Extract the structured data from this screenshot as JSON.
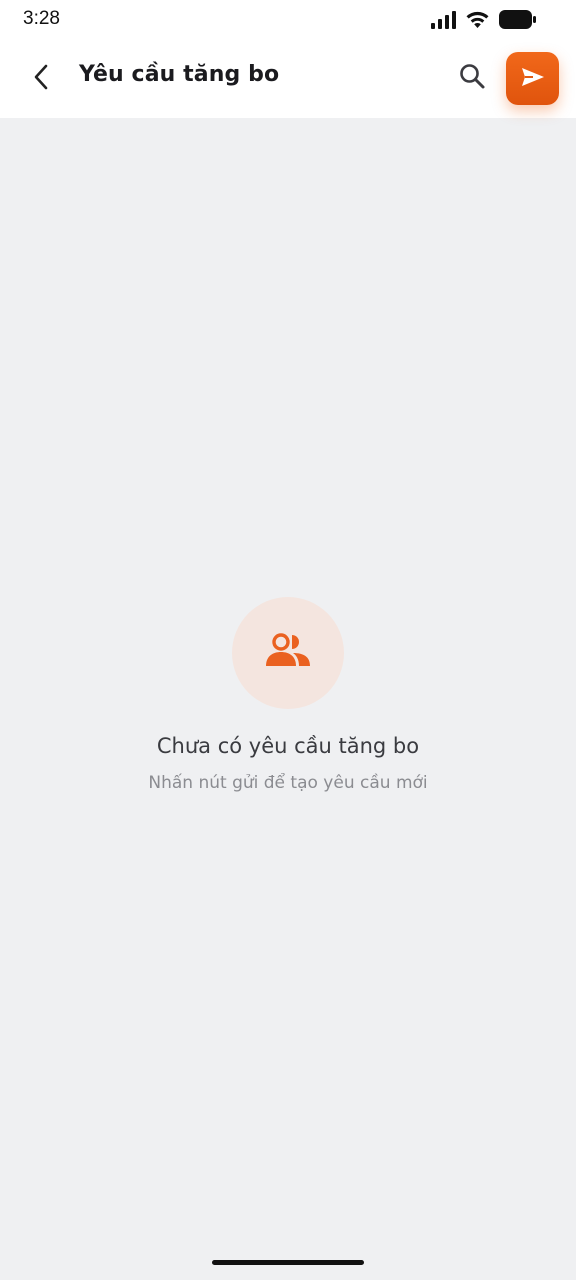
{
  "status_bar": {
    "time": "3:28",
    "icons": [
      "cellular-signal-icon",
      "wifi-icon",
      "battery-icon"
    ]
  },
  "header": {
    "title": "Yêu cầu tăng bo",
    "back_icon": "chevron-left-icon",
    "search_icon": "search-icon",
    "send_icon": "send-icon"
  },
  "empty_state": {
    "icon": "users-icon",
    "title": "Chưa có yêu cầu tăng bo",
    "subtitle": "Nhấn nút gửi để tạo yêu cầu mới"
  },
  "colors": {
    "accent": "#ef661e",
    "background": "#eff0f2",
    "header_background": "#ffffff",
    "icon_circle": "#f4e5df"
  }
}
